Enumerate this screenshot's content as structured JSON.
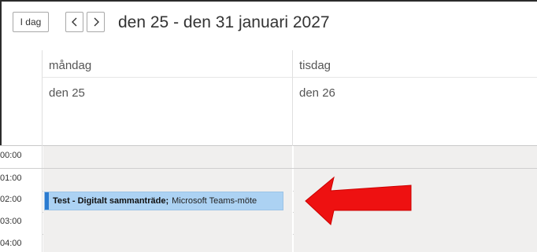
{
  "toolbar": {
    "today_label": "I dag",
    "prev_icon": "chevron-left-icon",
    "next_icon": "chevron-right-icon",
    "range_title": "den 25 - den 31 januari 2027"
  },
  "days": [
    {
      "name": "måndag",
      "date": "den 25"
    },
    {
      "name": "tisdag",
      "date": "den 26"
    }
  ],
  "time_slots": [
    "00:00",
    "01:00",
    "02:00",
    "03:00",
    "04:00"
  ],
  "event": {
    "title": "Test - Digitalt sammanträde",
    "separator": ";",
    "location": "Microsoft Teams-möte",
    "color": "#acd2f3",
    "accent": "#2b7bd0"
  },
  "annotation": {
    "arrow_color": "#ee1111"
  }
}
